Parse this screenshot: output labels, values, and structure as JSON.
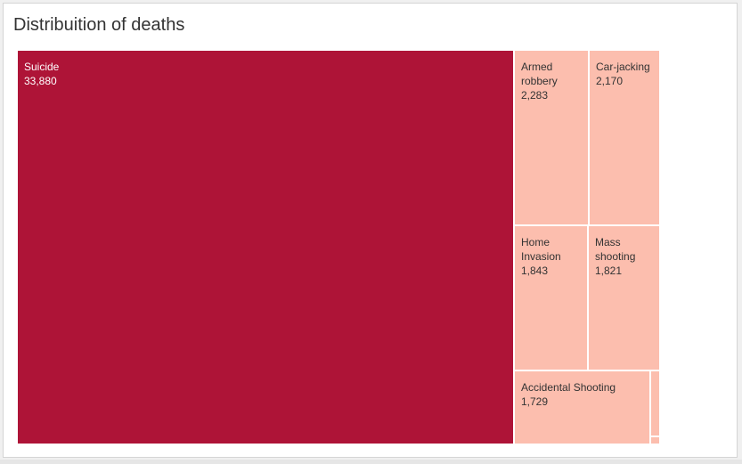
{
  "title": "Distribuition of deaths",
  "chart_data": {
    "type": "treemap",
    "title": "Distribuition of deaths",
    "colors": {
      "dark": "#ae1437",
      "light": "#fcbeae",
      "dark_text": "#ffffff",
      "light_text": "#333333"
    },
    "items": [
      {
        "name": "Suicide",
        "label_lines": [
          "Suicide"
        ],
        "value": 33880,
        "value_label": "33,880",
        "shade": "dark"
      },
      {
        "name": "Armed robbery",
        "label_lines": [
          "Armed",
          "robbery"
        ],
        "value": 2283,
        "value_label": "2,283",
        "shade": "light"
      },
      {
        "name": "Car-jacking",
        "label_lines": [
          "Car-jacking"
        ],
        "value": 2170,
        "value_label": "2,170",
        "shade": "light"
      },
      {
        "name": "Home Invasion",
        "label_lines": [
          "Home",
          "Invasion"
        ],
        "value": 1843,
        "value_label": "1,843",
        "shade": "light"
      },
      {
        "name": "Mass shooting",
        "label_lines": [
          "Mass",
          "shooting"
        ],
        "value": 1821,
        "value_label": "1,821",
        "shade": "light"
      },
      {
        "name": "Accidental Shooting",
        "label_lines": [
          "Accidental Shooting"
        ],
        "value": 1729,
        "value_label": "1,729",
        "shade": "light"
      }
    ]
  }
}
